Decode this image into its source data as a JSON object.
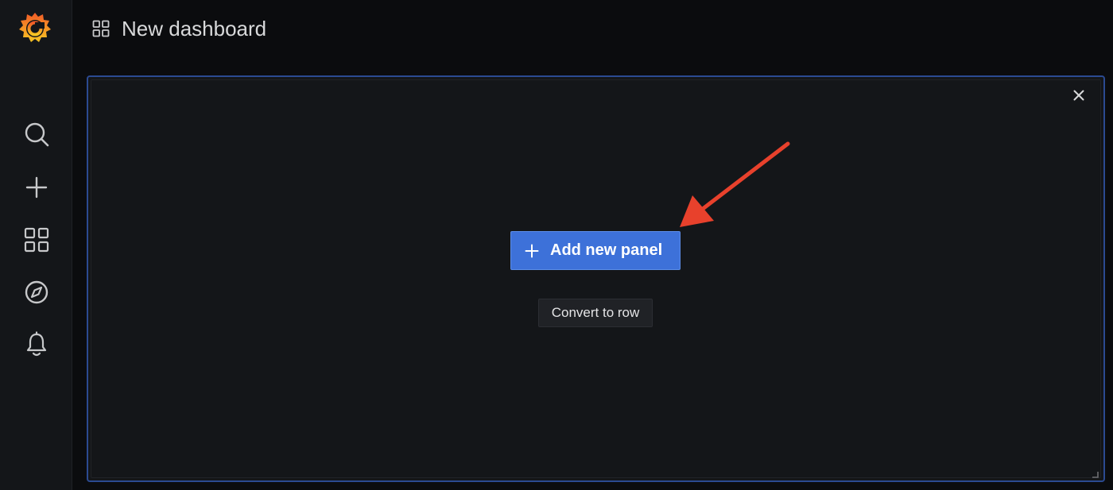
{
  "header": {
    "title": "New dashboard",
    "icon": "dashboard-grid-icon"
  },
  "sidebar": {
    "logo": "grafana-logo",
    "items": [
      {
        "name": "search",
        "icon": "search-icon"
      },
      {
        "name": "create",
        "icon": "plus-icon"
      },
      {
        "name": "dashboards",
        "icon": "dashboards-grid-icon"
      },
      {
        "name": "explore",
        "icon": "compass-icon"
      },
      {
        "name": "alerting",
        "icon": "bell-icon"
      }
    ]
  },
  "panel": {
    "add_new_panel_label": "Add new panel",
    "convert_to_row_label": "Convert to row",
    "close_icon": "close-icon"
  },
  "annotation": {
    "arrow_color": "#e8412c"
  },
  "colors": {
    "accent": "#3d71d9",
    "panel_border": "#2b4a91",
    "background": "#0b0c0e",
    "sidebar": "#141619"
  }
}
